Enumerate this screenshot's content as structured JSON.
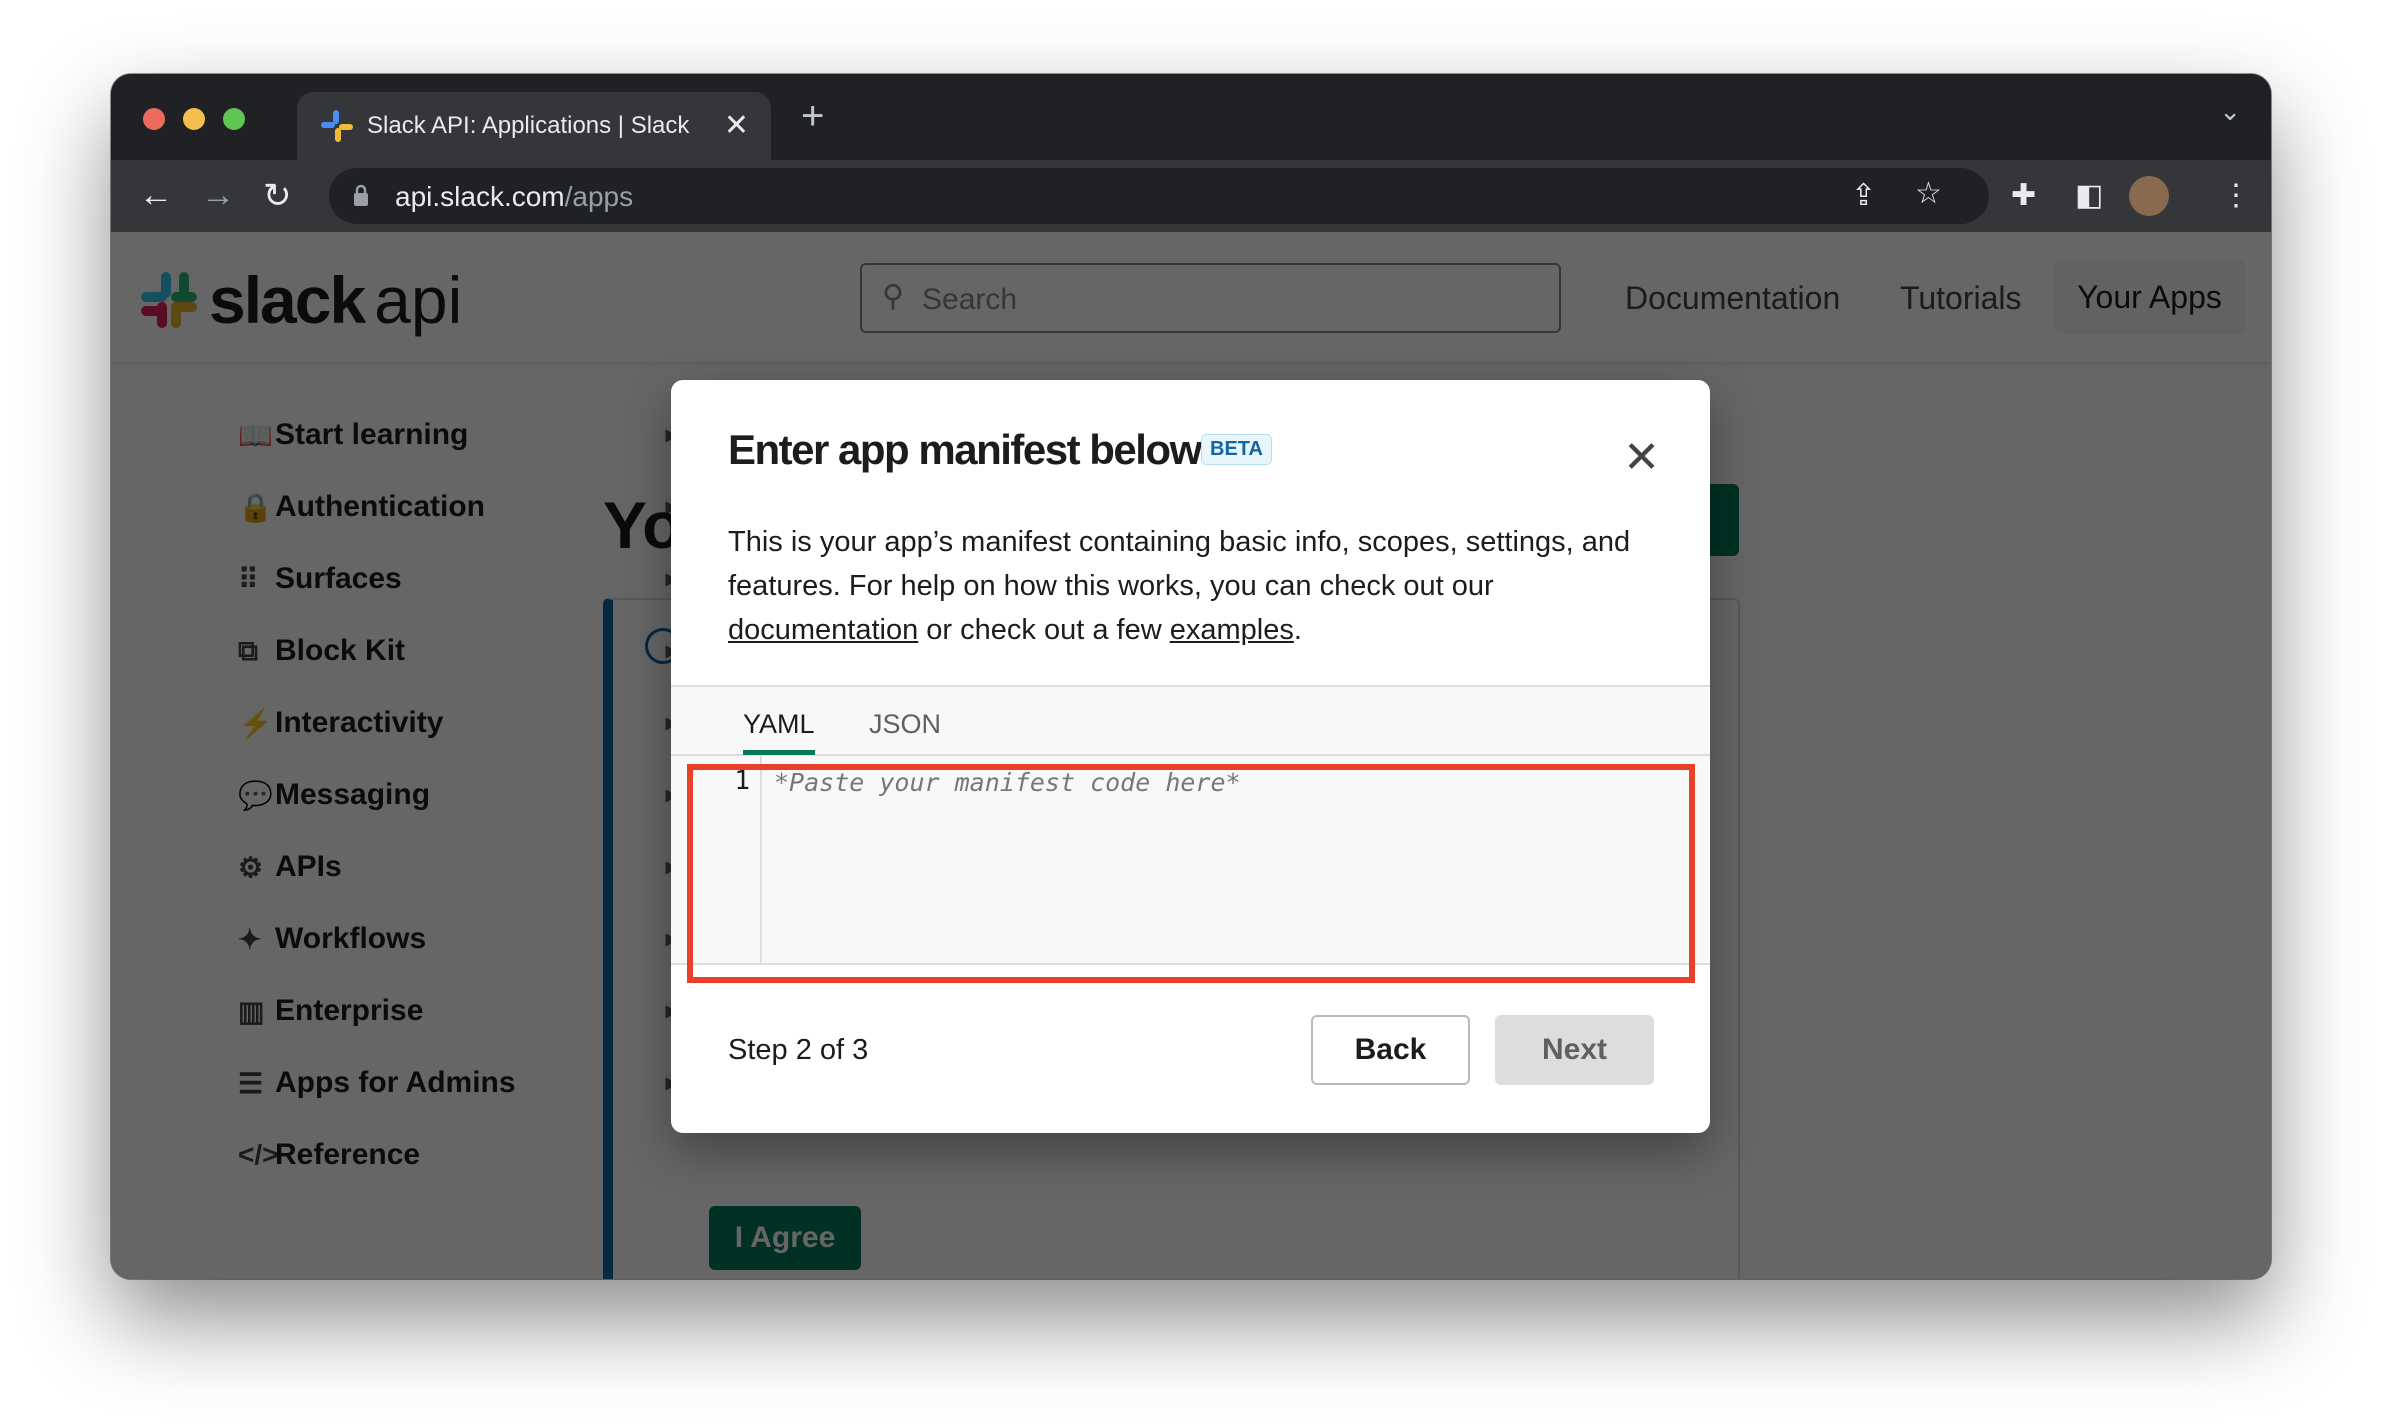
{
  "browser": {
    "tab_title": "Slack API: Applications | Slack",
    "url_host": "api.slack.com",
    "url_path": "/apps",
    "colors": {
      "close": "#ed6a5e",
      "minimize": "#f5bf4f",
      "maximize": "#61c554"
    }
  },
  "header": {
    "logo_word": "slack",
    "logo_suffix": "api",
    "search_placeholder": "Search",
    "links": [
      "Documentation",
      "Tutorials"
    ],
    "your_apps": "Your Apps"
  },
  "sidebar": {
    "items": [
      {
        "label": "Start learning",
        "icon": "book-icon",
        "glyph": "📖",
        "chevron": true
      },
      {
        "label": "Authentication",
        "icon": "lock-icon",
        "glyph": "🔒",
        "chevron": true
      },
      {
        "label": "Surfaces",
        "icon": "grid-icon",
        "glyph": "⠿",
        "chevron": true
      },
      {
        "label": "Block Kit",
        "icon": "blocks-icon",
        "glyph": "⧉",
        "chevron": true
      },
      {
        "label": "Interactivity",
        "icon": "interactivity-icon",
        "glyph": "⚡",
        "chevron": true
      },
      {
        "label": "Messaging",
        "icon": "message-icon",
        "glyph": "💬",
        "chevron": true
      },
      {
        "label": "APIs",
        "icon": "gears-icon",
        "glyph": "⚙",
        "chevron": true
      },
      {
        "label": "Workflows",
        "icon": "wand-icon",
        "glyph": "✦",
        "chevron": true
      },
      {
        "label": "Enterprise",
        "icon": "building-icon",
        "glyph": "▥",
        "chevron": true
      },
      {
        "label": "Apps for Admins",
        "icon": "sliders-icon",
        "glyph": "☰",
        "chevron": true
      },
      {
        "label": "Reference",
        "icon": "code-icon",
        "glyph": "</>",
        "chevron": false
      }
    ]
  },
  "background": {
    "heading_partial": "Yo",
    "agree_button": "I Agree"
  },
  "modal": {
    "title": "Enter app manifest below",
    "badge": "BETA",
    "desc_1": "This is your app’s manifest containing basic info, scopes, settings, and features. For help on how this works, you can check out our ",
    "link_docs": "documentation",
    "desc_2": " or check out a few ",
    "link_examples": "examples",
    "desc_3": ".",
    "tabs": [
      {
        "label": "YAML",
        "active": true
      },
      {
        "label": "JSON",
        "active": false
      }
    ],
    "editor": {
      "line_number": "1",
      "placeholder": "*Paste your manifest code here*"
    },
    "step": "Step 2 of 3",
    "back": "Back",
    "next": "Next",
    "next_disabled": true,
    "accent": "#007a5a",
    "highlight": "#e8412a"
  }
}
